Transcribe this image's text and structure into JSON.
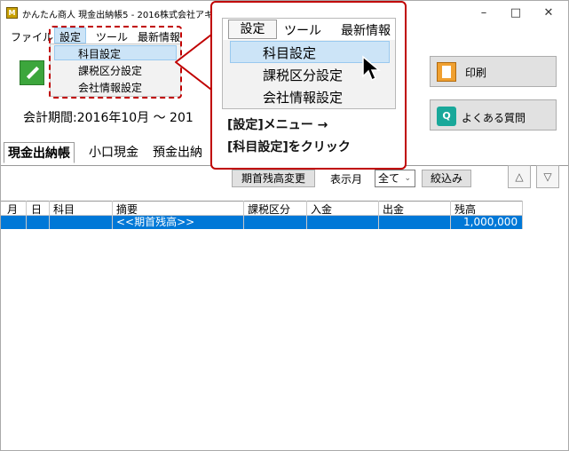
{
  "window": {
    "title": "かんたん商人 現金出納帳5 - 2016株式会社アキンド…",
    "minimize": "–",
    "maximize": "□",
    "close": "✕"
  },
  "menubar": {
    "file": "ファイル",
    "settings": "設定",
    "tools": "ツール",
    "latest": "最新情報"
  },
  "settings_menu": {
    "items": [
      "科目設定",
      "課税区分設定",
      "会社情報設定"
    ]
  },
  "zoom": {
    "settings": "設定",
    "tools": "ツール",
    "latest": "最新情報",
    "items": [
      "科目設定",
      "課税区分設定",
      "会社情報設定"
    ],
    "instruction_line1": "[設定]メニュー →",
    "instruction_line2": "[科目設定]をクリック"
  },
  "toolbar": {
    "print_label": "印刷",
    "faq_label": "よくある質問"
  },
  "period": {
    "text": "会計期間:2016年10月 ～ 201"
  },
  "tabs": [
    "現金出納帳",
    "小口現金",
    "預金出納"
  ],
  "filter": {
    "opening_balance_button": "期首残高変更",
    "display_month_label": "表示月",
    "month_select": "全て",
    "narrow_button": "絞込み",
    "up_arrow": "△",
    "down_arrow": "▽"
  },
  "grid": {
    "headers": [
      "月",
      "日",
      "科目",
      "摘要",
      "課税区分",
      "入金",
      "出金",
      "残高"
    ],
    "rows": [
      {
        "description": "<<期首残高>>",
        "balance": "1,000,000"
      }
    ]
  },
  "colors": {
    "accent_red": "#c00000",
    "selection_blue": "#0078d7",
    "menu_highlight": "#cce4f7"
  }
}
